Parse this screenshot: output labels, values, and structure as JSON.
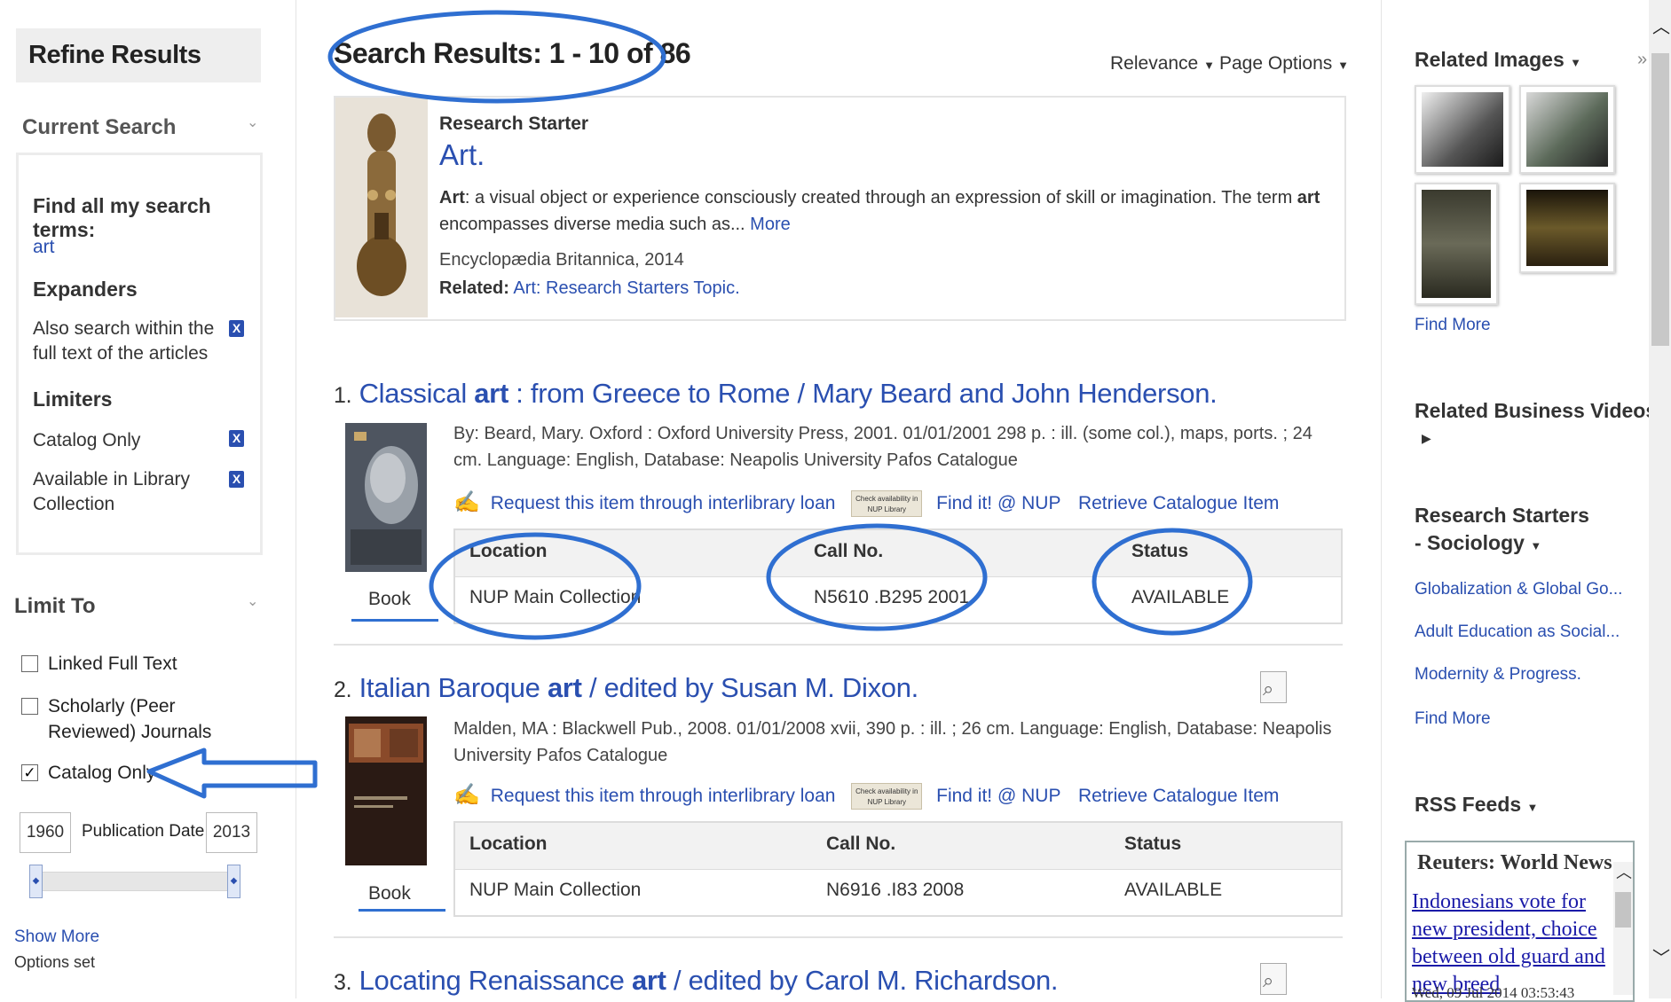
{
  "left": {
    "refine_title": "Refine Results",
    "current_search_title": "Current Search",
    "find_all_label": "Find all my search terms:",
    "search_term": "art",
    "expanders_title": "Expanders",
    "expander_item": "Also search within the full text of the articles",
    "limiters_title": "Limiters",
    "limiters": [
      "Catalog Only",
      "Available in Library Collection"
    ],
    "limit_to_title": "Limit To",
    "checkboxes": [
      {
        "label": "Linked Full Text",
        "checked": false
      },
      {
        "label": "Scholarly (Peer Reviewed) Journals",
        "checked": false
      },
      {
        "label": "Catalog Only",
        "checked": true
      }
    ],
    "date_from": "1960",
    "date_label": "Publication Date",
    "date_to": "2013",
    "show_more": "Show More",
    "options_set": "Options set"
  },
  "main": {
    "results_title": "Search Results: 1 - 10 of 86",
    "sort_label": "Relevance",
    "page_options_label": "Page Options",
    "research_starter": {
      "label": "Research Starter",
      "title": "Art.",
      "desc_prefix": "Art",
      "desc_text": ": a visual object or experience consciously created through an expression of skill or imagination. The term ",
      "desc_bold": "art",
      "desc_text2": " encompasses diverse media such as... ",
      "more": "More",
      "source": "Encyclopædia Britannica, 2014",
      "related_label": "Related:",
      "related_link1": "Art",
      "related_link2": ": Research Starters Topic."
    },
    "records": [
      {
        "num": "1.",
        "title_pre": "Classical ",
        "title_bold": "art",
        "title_post": " : from Greece to Rome / Mary Beard and John Henderson.",
        "meta": "By: Beard, Mary. Oxford : Oxford University Press, 2001. 01/01/2001 298 p. : ill. (some col.), maps, ports. ; 24 cm. Language: English, Database: Neapolis University Pafos Catalogue",
        "ill_link": "Request this item through interlibrary loan",
        "check_badge": "Check availability in NUP Library",
        "find_it": "Find it! @ NUP",
        "retrieve": "Retrieve Catalogue Item",
        "type": "Book",
        "holdings_headers": [
          "Location",
          "Call No.",
          "Status"
        ],
        "holdings_values": [
          "NUP Main Collection",
          "N5610 .B295 2001",
          "AVAILABLE"
        ]
      },
      {
        "num": "2.",
        "title_pre": "Italian Baroque ",
        "title_bold": "art",
        "title_post": " / edited by Susan M. Dixon.",
        "meta": "Malden, MA : Blackwell Pub., 2008. 01/01/2008 xvii, 390 p. : ill. ; 26 cm. Language: English, Database: Neapolis University Pafos Catalogue",
        "ill_link": "Request this item through interlibrary loan",
        "check_badge": "Check availability in NUP Library",
        "find_it": "Find it! @ NUP",
        "retrieve": "Retrieve Catalogue Item",
        "type": "Book",
        "holdings_headers": [
          "Location",
          "Call No.",
          "Status"
        ],
        "holdings_values": [
          "NUP Main Collection",
          "N6916 .I83 2008",
          "AVAILABLE"
        ]
      },
      {
        "num": "3.",
        "title_pre": "Locating Renaissance ",
        "title_bold": "art",
        "title_post": " / edited by Carol M. Richardson."
      }
    ]
  },
  "right": {
    "related_images_title": "Related Images",
    "find_more_1": "Find More",
    "related_videos_title": "Related Business Videos",
    "research_starters_title": "Research Starters - Sociology",
    "research_links": [
      "Globalization & Global Go...",
      "Adult Education as Social...",
      "Modernity & Progress.",
      "Find More"
    ],
    "rss_title": "RSS Feeds",
    "rss_box_title": "Reuters: World News",
    "rss_item": "Indonesians vote for new president, choice between old guard and new breed",
    "rss_date": "Wed, 09 Jul 2014 03:53:43"
  },
  "colors": {
    "link": "#2a4fb0",
    "annotation": "#2f6fd1"
  }
}
